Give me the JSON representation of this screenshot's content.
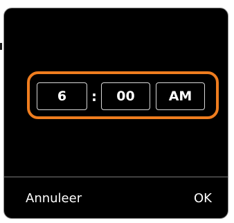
{
  "time_picker": {
    "hour": "6",
    "separator": ":",
    "minute": "00",
    "period": "AM",
    "highlight_color": "#ef7d1f"
  },
  "actions": {
    "cancel_label": "Annuleer",
    "ok_label": "OK"
  }
}
